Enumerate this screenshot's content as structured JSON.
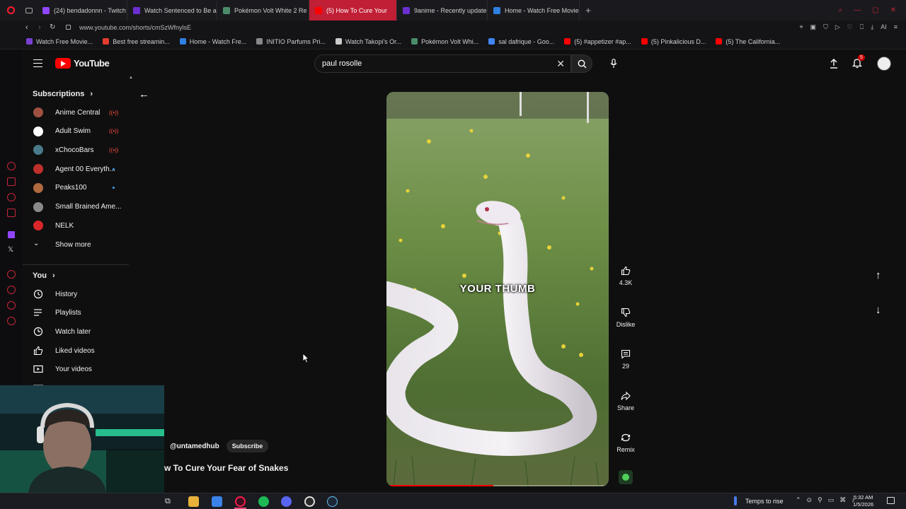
{
  "browser": {
    "tabs": [
      {
        "label": "(24) bendadonnn - Twitch",
        "color": "#9146ff"
      },
      {
        "label": "Watch Sentenced to Be a",
        "color": "#6b2fd0"
      },
      {
        "label": "Pokémon Volt White 2 Re",
        "color": "#4a8c6a"
      },
      {
        "label": "(5) How To Cure Your",
        "color": "#ff0000",
        "active": true
      },
      {
        "label": "9anime - Recently update",
        "color": "#6b2fd0"
      },
      {
        "label": "Home - Watch Free Movie",
        "color": "#2f7fe0"
      }
    ],
    "url": "www.youtube.com/shorts/cmSzWfnylsE",
    "bookmarks": [
      {
        "label": "Watch Free Movie...",
        "color": "#7a3fd0"
      },
      {
        "label": "Best free streamin...",
        "color": "#e63c2e"
      },
      {
        "label": "Home - Watch Fre...",
        "color": "#2f7fe0"
      },
      {
        "label": "INITIO Parfums Pri...",
        "color": "#888888"
      },
      {
        "label": "Watch Takopi's Or...",
        "color": "#cccccc"
      },
      {
        "label": "Pokémon Volt Whi...",
        "color": "#4a8c6a"
      },
      {
        "label": "sal dafrique - Goo...",
        "color": "#4285f4"
      },
      {
        "label": "(5) #appetizer #ap...",
        "color": "#ff0000"
      },
      {
        "label": "(5) Pinkalicious D...",
        "color": "#ff0000"
      },
      {
        "label": "(5) The California...",
        "color": "#ff0000"
      }
    ]
  },
  "youtube": {
    "logo_text": "YouTube",
    "search_value": "paul rosolle",
    "notification_count": "5",
    "sidebar": {
      "subscriptions_header": "Subscriptions",
      "channels": [
        {
          "name": "Anime Central",
          "indicator": "live",
          "color": "#a05040"
        },
        {
          "name": "Adult Swim",
          "indicator": "live",
          "color": "#ffffff"
        },
        {
          "name": "xChocoBars",
          "indicator": "live",
          "color": "#4a7a8a"
        },
        {
          "name": "Agent 00 Everyth...",
          "indicator": "new",
          "color": "#c0302a"
        },
        {
          "name": "Peaks100",
          "indicator": "new",
          "color": "#b06a40"
        },
        {
          "name": "Small Brained Ame...",
          "indicator": "",
          "color": "#8a8a8a"
        },
        {
          "name": "NELK",
          "indicator": "",
          "color": "#d8262b"
        }
      ],
      "show_more": "Show more",
      "you_header": "You",
      "you_items": [
        "History",
        "Playlists",
        "Watch later",
        "Liked videos",
        "Your videos"
      ]
    },
    "short": {
      "caption_overlay": "YOUR THUMB",
      "channel": "@untamedhub",
      "subscribe_label": "Subscribe",
      "title": "w To Cure Your Fear of Snakes",
      "likes": "4.3K",
      "dislike_label": "Dislike",
      "comments": "29",
      "share_label": "Share",
      "remix_label": "Remix"
    }
  },
  "taskbar": {
    "weather": "Temps to rise",
    "time": "5:32 AM",
    "date": "1/5/2026"
  }
}
